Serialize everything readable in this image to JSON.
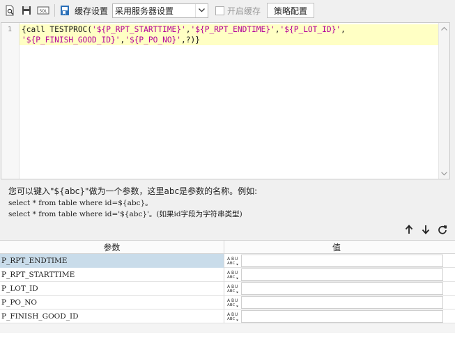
{
  "toolbar": {
    "cache_label": "缓存设置",
    "cache_select_value": "采用服务器设置",
    "enable_cache_label": "开启缓存",
    "enable_cache_checked": false,
    "strategy_button": "策略配置"
  },
  "editor": {
    "line_number": "1",
    "lines": [
      [
        {
          "t": "{call TESTPROC(",
          "k": "plain"
        },
        {
          "t": "'${P_RPT_STARTTIME}'",
          "k": "str"
        },
        {
          "t": ",",
          "k": "plain"
        },
        {
          "t": "'${P_RPT_ENDTIME}'",
          "k": "str"
        },
        {
          "t": ",",
          "k": "plain"
        },
        {
          "t": "'${P_LOT_ID}'",
          "k": "str"
        },
        {
          "t": ",",
          "k": "plain"
        }
      ],
      [
        {
          "t": "'${P_FINISH_GOOD_ID}'",
          "k": "str"
        },
        {
          "t": ",",
          "k": "plain"
        },
        {
          "t": "'${P_PO_NO}'",
          "k": "str"
        },
        {
          "t": ",?)}",
          "k": "plain"
        }
      ]
    ]
  },
  "help": {
    "line1": "您可以键入\"${abc}\"做为一个参数，这里abc是参数的名称。例如:",
    "line2": "select * from table where id=${abc}。",
    "line3": "select * from table where id='${abc}'。(如果id字段为字符串类型)"
  },
  "params_table": {
    "header_name": "参数",
    "header_value": "值",
    "rows": [
      {
        "name": "P_RPT_ENDTIME",
        "value": "",
        "selected": true
      },
      {
        "name": "P_RPT_STARTTIME",
        "value": "",
        "selected": false
      },
      {
        "name": "P_LOT_ID",
        "value": "",
        "selected": false
      },
      {
        "name": "P_PO_NO",
        "value": "",
        "selected": false
      },
      {
        "name": "P_FINISH_GOOD_ID",
        "value": "",
        "selected": false
      }
    ]
  },
  "icons": {
    "preview": "preview-search-icon",
    "save": "save-icon",
    "sql": "sql-icon",
    "cache": "cache-bookmark-icon",
    "move_up": "arrow-up-icon",
    "move_down": "arrow-down-icon",
    "refresh": "refresh-icon",
    "type": "abc-type-icon"
  },
  "colors": {
    "line_highlight": "#ffffc4",
    "string_literal": "#b3009a",
    "row_selected": "#c9dcea"
  }
}
